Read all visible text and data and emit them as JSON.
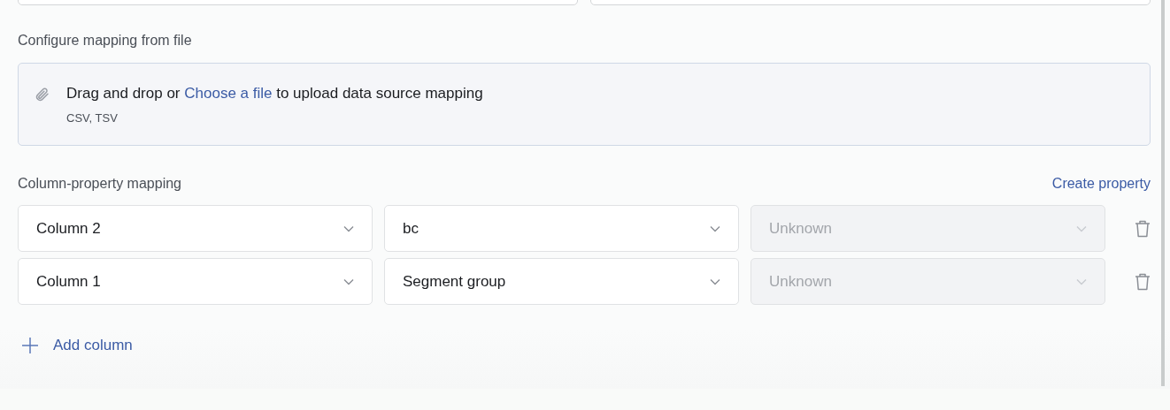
{
  "top_fields": [
    {
      "kind": "input"
    },
    {
      "kind": "input"
    }
  ],
  "file_section": {
    "label": "Configure mapping from file",
    "text_before": "Drag and drop or ",
    "link": "Choose a file",
    "text_after": " to upload data source mapping",
    "formats": "CSV, TSV"
  },
  "mapping": {
    "label": "Column-property mapping",
    "create_link": "Create property",
    "rows": [
      {
        "column": {
          "value": "Column 2",
          "disabled": false
        },
        "property": {
          "value": "bc",
          "disabled": false
        },
        "type": {
          "value": "Unknown",
          "disabled": true
        }
      },
      {
        "column": {
          "value": "Column 1",
          "disabled": false
        },
        "property": {
          "value": "Segment group",
          "disabled": false
        },
        "type": {
          "value": "Unknown",
          "disabled": true
        }
      }
    ],
    "add_button": "Add column"
  }
}
